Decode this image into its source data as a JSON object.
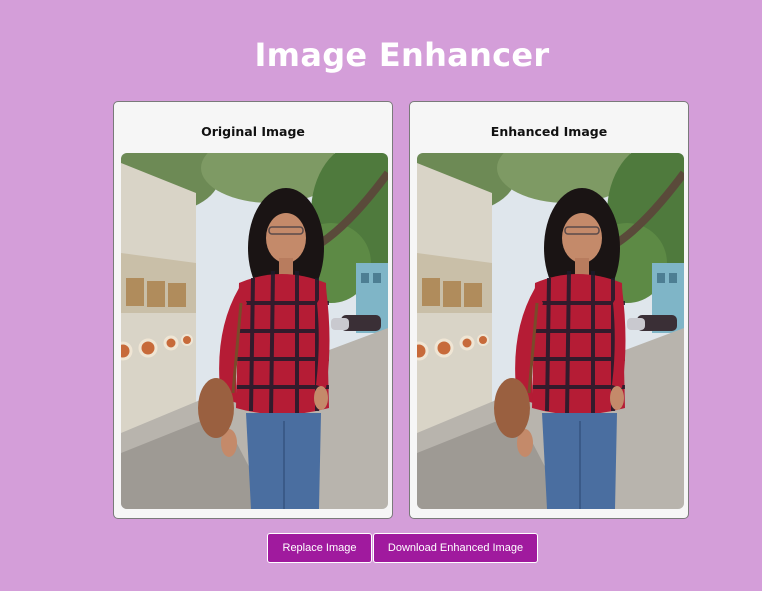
{
  "header": {
    "title": "Image Enhancer"
  },
  "panels": {
    "original": {
      "title": "Original Image",
      "image_icon": "photo-woman-street"
    },
    "enhanced": {
      "title": "Enhanced Image",
      "image_icon": "photo-woman-street"
    }
  },
  "actions": {
    "replace_label": "Replace Image",
    "download_label": "Download Enhanced Image"
  },
  "colors": {
    "background": "#d49ed9",
    "button": "#a01a9e",
    "card": "#f6f6f6"
  }
}
